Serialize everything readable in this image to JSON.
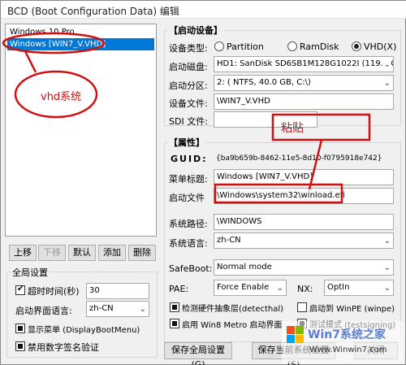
{
  "window": {
    "title": "BCD (Boot Configuration Data) 编辑"
  },
  "boot_list": {
    "items": [
      {
        "label": "Windows 10 Pro",
        "selected": false
      },
      {
        "label": "Windows [WIN7_V.VHD]",
        "selected": true
      }
    ]
  },
  "list_buttons": {
    "up": "上移",
    "down": "下移",
    "default": "默认",
    "add": "添加",
    "delete": "删除"
  },
  "global": {
    "title": "全局设置",
    "timeout_label": "超时时间(秒)",
    "timeout_checked": true,
    "timeout_value": "30",
    "lang_label": "启动界面语言:",
    "lang_value": "zh-CN",
    "show_menu_label": "显示菜单 (DisplayBootMenu)",
    "disable_sig_label": "禁用数字签名验证",
    "save_button": "保存全局设置(G)"
  },
  "boot_device": {
    "title": "启动设备",
    "type_label": "设备类型:",
    "types": [
      "Partition",
      "RamDisk",
      "VHD(X)"
    ],
    "selected_type": "VHD(X)",
    "disk_label": "启动磁盘:",
    "disk_value": "HD1: SanDisk SD6SB1M128G1022I (119.2 GB, (",
    "partition_label": "启动分区:",
    "partition_value": "2: ( NTFS,  40.0 GB, C:\\)",
    "file_label": "设备文件:",
    "file_value": "\\WIN7_V.VHD",
    "sdi_label": "SDI 文件:",
    "sdi_value": ""
  },
  "attributes": {
    "title": "属性",
    "guid_label": "GUID:",
    "guid_value": "{ba9b659b-8462-11e5-8d10-f0795918e742}",
    "menu_title_label": "菜单标题:",
    "menu_title_value": "Windows [WIN7_V.VHD]",
    "boot_file_label": "启动文件",
    "boot_file_value": "\\Windows\\system32\\winload.efi",
    "sys_path_label": "系统路径:",
    "sys_path_value": "\\WINDOWS",
    "sys_lang_label": "系统语言:",
    "sys_lang_value": "zh-CN",
    "safeboot_label": "SafeBoot:",
    "safeboot_value": "Normal mode",
    "pae_label": "PAE:",
    "pae_value": "Force Enable",
    "nx_label": "NX:",
    "nx_value": "OptIn",
    "detecthal_label": "检测硬件抽象层(detecthal)",
    "winpe_label": "启动到 WinPE (winpe)",
    "metro_label": "启用 Win8 Metro 启动界面",
    "testsigning_label": "测试模式 (testsigning)",
    "save_button": "保存当前系统设置(S)",
    "close_button": "关闭"
  },
  "annotations": {
    "vhd_note": "vhd系统",
    "paste_note": "粘贴"
  },
  "watermark": {
    "brand": "Win7系统之家",
    "url": "Www.Winwin7.com"
  },
  "colors": {
    "annotation_red": "#d01010",
    "selection_blue": "#0078d7"
  }
}
